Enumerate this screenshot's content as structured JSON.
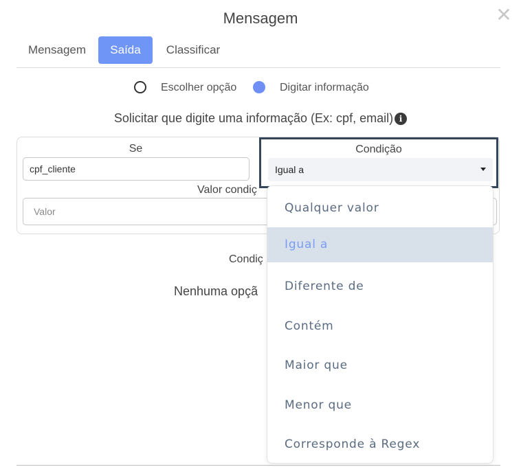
{
  "modal": {
    "title": "Mensagem",
    "close_icon": "close-icon"
  },
  "tabs": [
    {
      "label": "Mensagem",
      "active": false
    },
    {
      "label": "Saída",
      "active": true
    },
    {
      "label": "Classificar",
      "active": false
    }
  ],
  "mode": {
    "options": [
      {
        "label": "Escolher opção",
        "selected": false
      },
      {
        "label": "Digitar informação",
        "selected": true
      }
    ]
  },
  "prompt": {
    "text": "Solicitar que digite uma informação (Ex: cpf, email)",
    "info_icon": "info-icon"
  },
  "form": {
    "se_label": "Se",
    "se_value": "cpf_cliente",
    "condicao_label": "Condição",
    "condicao_value": "Igual a",
    "valor_label": "Valor condiç",
    "valor_placeholder": "Valor"
  },
  "below": {
    "condicoes_label": "Condiç",
    "empty_text": "Nenhuma opçã"
  },
  "dropdown": {
    "options": [
      {
        "label": "Qualquer valor",
        "selected": false
      },
      {
        "label": "Igual a",
        "selected": true
      },
      {
        "label": "Diferente de",
        "selected": false
      },
      {
        "label": "Contém",
        "selected": false
      },
      {
        "label": "Maior que",
        "selected": false
      },
      {
        "label": "Menor que",
        "selected": false
      },
      {
        "label": "Corresponde à Regex",
        "selected": false
      }
    ]
  },
  "colors": {
    "accent": "#6f95f7",
    "selected_bg": "#d8e0ea",
    "focus_border": "#36465a"
  }
}
